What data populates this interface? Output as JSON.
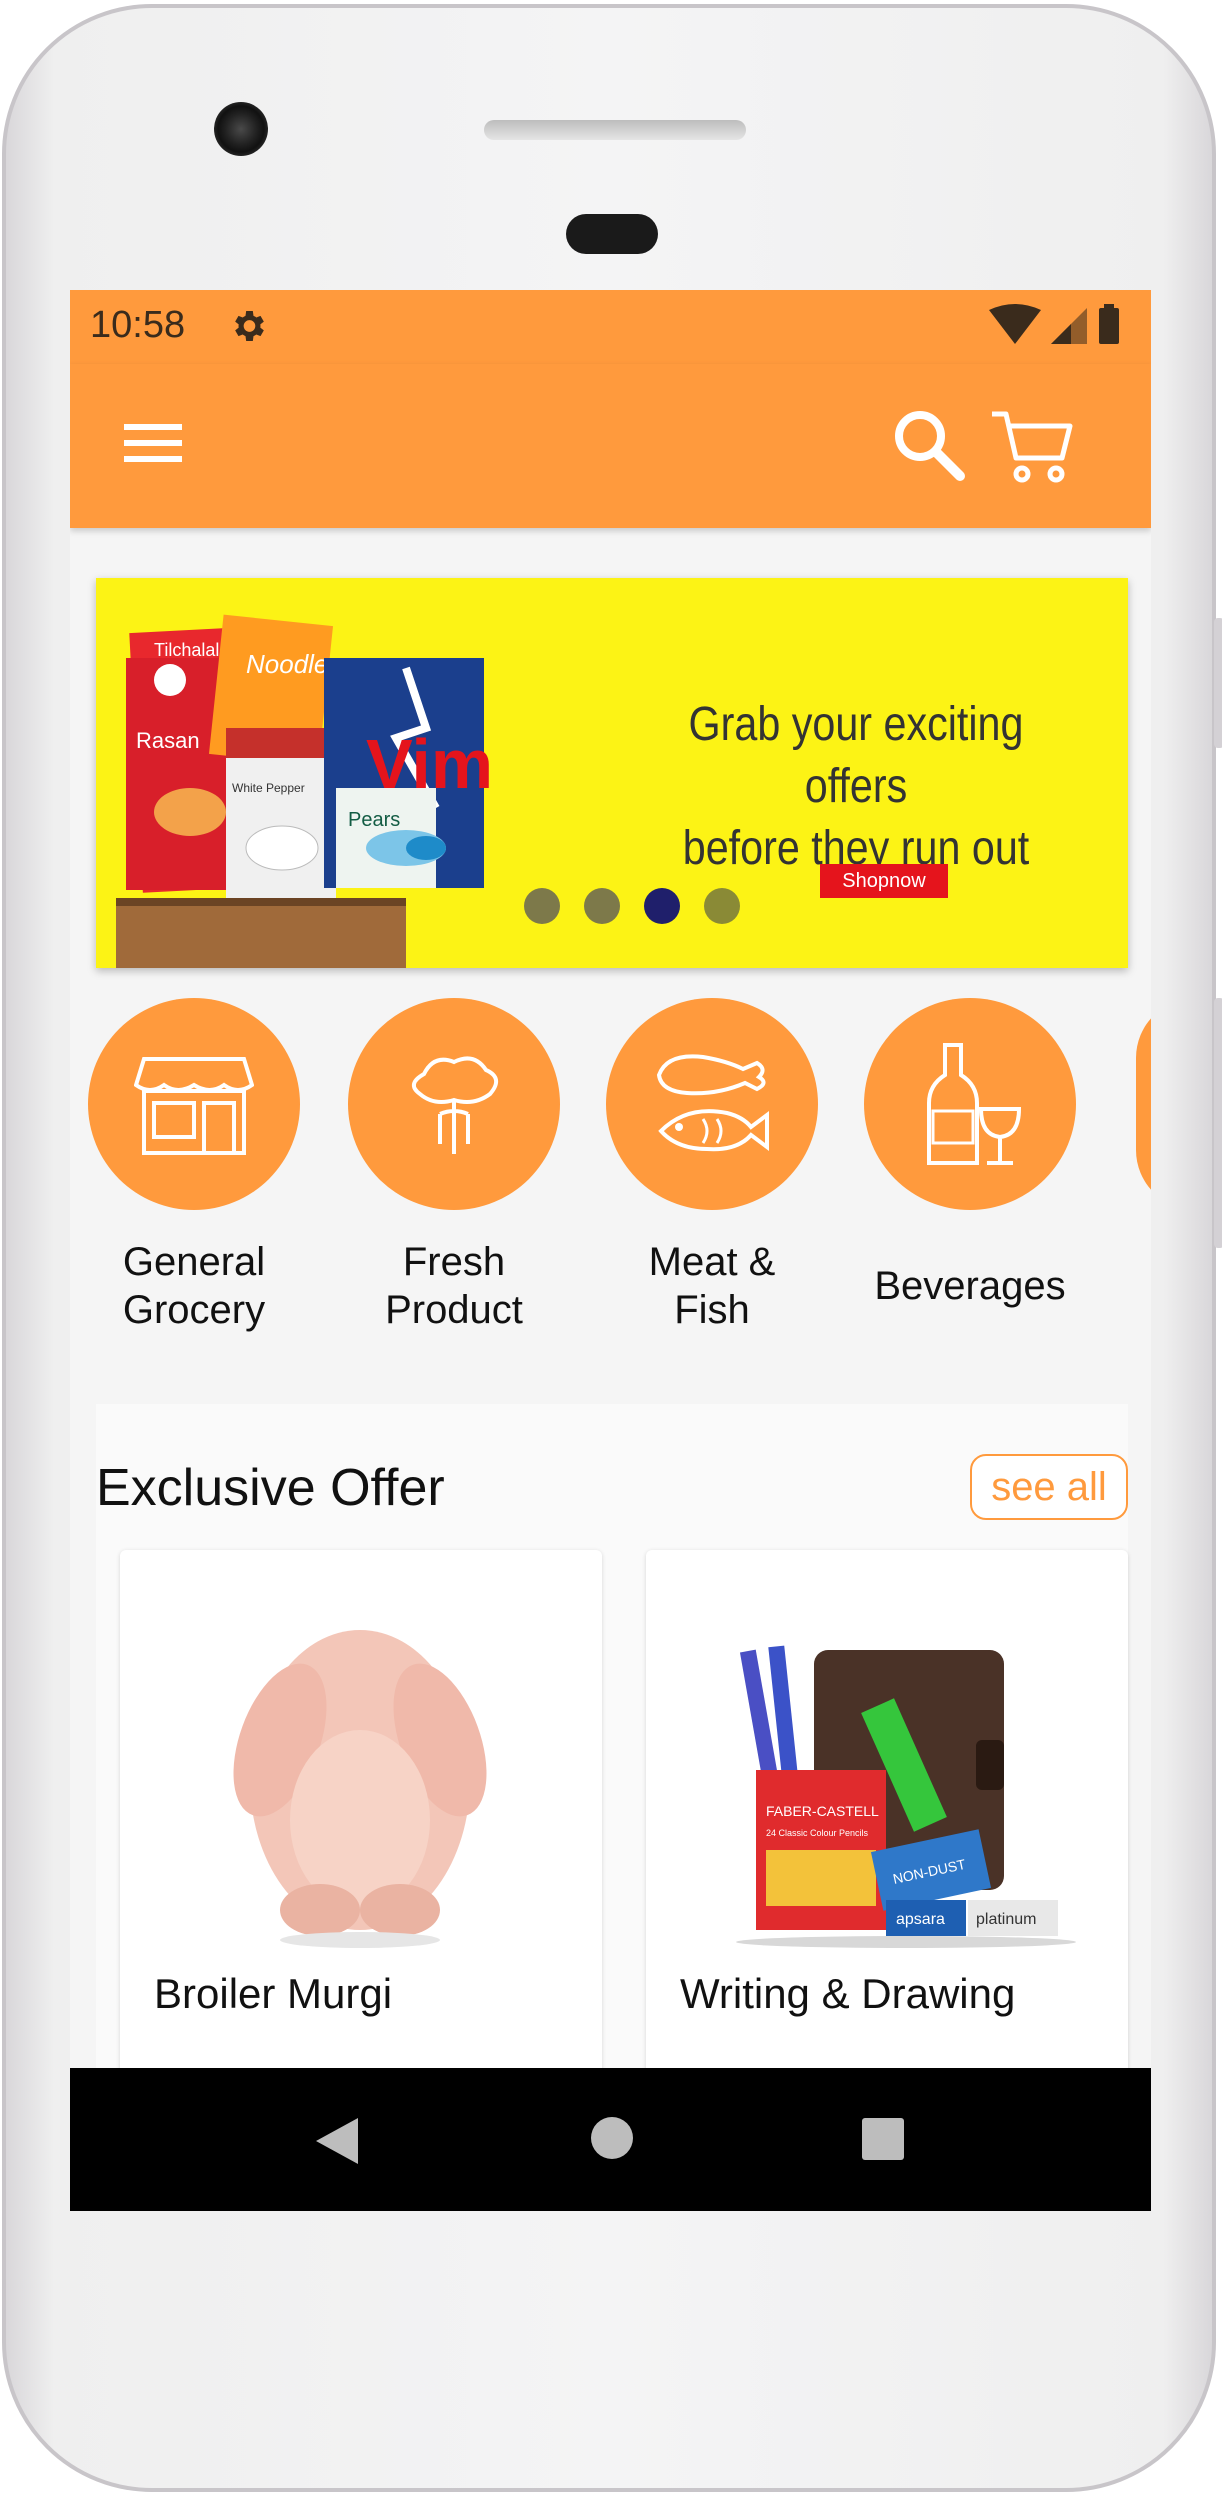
{
  "status_bar": {
    "time": "10:58",
    "icons": [
      "gear-icon",
      "wifi-icon",
      "signal-icon",
      "battery-icon"
    ]
  },
  "app_bar": {
    "icons": [
      "menu-icon",
      "search-icon",
      "cart-icon"
    ],
    "color": "#ff9a3d"
  },
  "banner": {
    "headline_line1": "Grab your exciting offers",
    "headline_line2": "before they run out",
    "button_label": "Shopnow",
    "product_labels": [
      "Tilchalal",
      "Noodles",
      "Rasan",
      "White Pepper",
      "Pears",
      "Vim"
    ],
    "slide_count": 4,
    "active_slide": 3,
    "background": "#fcf315"
  },
  "categories": [
    {
      "line1": "General",
      "line2": "Grocery",
      "icon": "store-icon"
    },
    {
      "line1": "Fresh",
      "line2": "Product",
      "icon": "vegetable-icon"
    },
    {
      "line1": "Meat &",
      "line2": "Fish",
      "icon": "meat-fish-icon"
    },
    {
      "line1": "Beverages",
      "line2": "",
      "icon": "bottle-glass-icon"
    }
  ],
  "exclusive_offer": {
    "title": "Exclusive Offer",
    "see_all": "see all",
    "products": [
      {
        "name": "Broiler Murgi",
        "image": "chicken-image"
      },
      {
        "name": "Writing & Drawing",
        "image": "stationery-image",
        "image_labels": [
          "FABER-CASTELL",
          "24 Classic Colour Pencils",
          "NON-DUST",
          "apsara",
          "platinum"
        ]
      }
    ]
  },
  "nav_bar": {
    "icons": [
      "back-icon",
      "home-icon",
      "recents-icon"
    ]
  }
}
